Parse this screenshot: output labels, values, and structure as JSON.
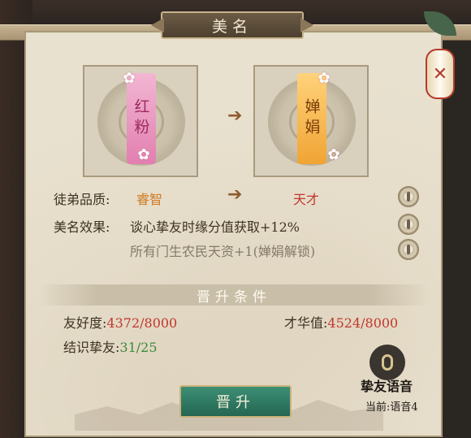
{
  "title": "美名",
  "from_card": {
    "name": "红粉"
  },
  "to_card": {
    "name": "婵娟"
  },
  "quality": {
    "label": "徒弟品质:",
    "from": "睿智",
    "to": "天才"
  },
  "effect": {
    "label": "美名效果:",
    "line1": "谈心挚友时缘分值获取+12%",
    "line2": "所有门生农民天资+1(婵娟解锁)"
  },
  "conditions": {
    "title": "晋升条件",
    "favor_label": "友好度:",
    "favor_value": "4372/8000",
    "talent_label": "才华值:",
    "talent_value": "4524/8000",
    "friends_label": "结识挚友:",
    "friends_value": "31/25"
  },
  "promote_button": "晋升",
  "voice": {
    "label": "挚友语音",
    "current": "当前:语音4"
  },
  "lantern_symbol": "✕",
  "colors": {
    "pink_tag": "#e58fb9",
    "orange_tag": "#f0a434",
    "red_value": "#c2362c",
    "green_value": "#3d8a3a",
    "promote": "#2f7d64"
  }
}
